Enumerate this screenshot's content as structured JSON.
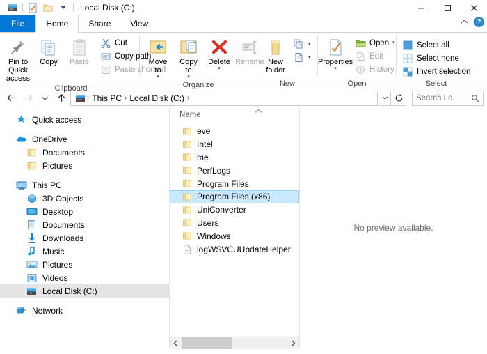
{
  "window": {
    "title": "Local Disk (C:)",
    "quick_access_toolbar": [
      {
        "name": "drive-icon",
        "label": "Local Disk"
      },
      {
        "name": "properties-check-icon",
        "label": "Properties"
      },
      {
        "name": "new-folder-icon",
        "label": "New folder"
      },
      {
        "name": "customize-qat-icon",
        "label": "Customize Quick Access Toolbar"
      }
    ],
    "controls": {
      "minimize": "—",
      "maximize": "□",
      "close": "✕",
      "collapse_ribbon": "⌃",
      "help": "?"
    }
  },
  "tabs": [
    {
      "label": "File",
      "active": false,
      "file": true
    },
    {
      "label": "Home",
      "active": true,
      "file": false
    },
    {
      "label": "Share",
      "active": false,
      "file": false
    },
    {
      "label": "View",
      "active": false,
      "file": false
    }
  ],
  "ribbon": {
    "groups": [
      {
        "name": "clipboard",
        "label": "Clipboard",
        "big_buttons": [
          {
            "label": "Pin to Quick access",
            "icon": "pin-icon",
            "disabled": false
          },
          {
            "label": "Copy",
            "icon": "copy-icon",
            "disabled": false
          },
          {
            "label": "Paste",
            "icon": "paste-icon",
            "disabled": true
          }
        ],
        "small_buttons": [
          {
            "label": "Cut",
            "icon": "scissors-icon",
            "disabled": false
          },
          {
            "label": "Copy path",
            "icon": "copy-path-icon",
            "disabled": false
          },
          {
            "label": "Paste shortcut",
            "icon": "paste-shortcut-icon",
            "disabled": true
          }
        ]
      },
      {
        "name": "organize",
        "label": "Organize",
        "big_buttons": [
          {
            "label": "Move to",
            "icon": "move-to-icon",
            "disabled": false,
            "dropdown": true
          },
          {
            "label": "Copy to",
            "icon": "copy-to-icon",
            "disabled": false,
            "dropdown": true
          },
          {
            "label": "Delete",
            "icon": "delete-x-icon",
            "disabled": false,
            "dropdown": true
          },
          {
            "label": "Rename",
            "icon": "rename-icon",
            "disabled": true
          }
        ],
        "small_buttons": []
      },
      {
        "name": "new",
        "label": "New",
        "big_buttons": [
          {
            "label": "New folder",
            "icon": "new-folder-icon",
            "disabled": false
          }
        ],
        "small_buttons": [
          {
            "label": "",
            "icon": "new-item-icon",
            "disabled": false,
            "dropdown": true
          },
          {
            "label": "",
            "icon": "easy-access-icon",
            "disabled": false,
            "dropdown": true
          }
        ]
      },
      {
        "name": "open",
        "label": "Open",
        "big_buttons": [
          {
            "label": "Properties",
            "icon": "properties-icon",
            "disabled": false,
            "dropdown": true
          }
        ],
        "small_buttons": [
          {
            "label": "Open",
            "icon": "open-folder-icon",
            "disabled": false,
            "dropdown": true
          },
          {
            "label": "Edit",
            "icon": "edit-icon",
            "disabled": true
          },
          {
            "label": "History",
            "icon": "history-icon",
            "disabled": true
          }
        ]
      },
      {
        "name": "select",
        "label": "Select",
        "big_buttons": [],
        "small_buttons": [
          {
            "label": "Select all",
            "icon": "select-all-icon",
            "disabled": false
          },
          {
            "label": "Select none",
            "icon": "select-none-icon",
            "disabled": false
          },
          {
            "label": "Invert selection",
            "icon": "invert-selection-icon",
            "disabled": false
          }
        ]
      }
    ]
  },
  "address_bar": {
    "back": "←",
    "forward": "→",
    "recent": "⌄",
    "up": "↑",
    "breadcrumbs": [
      {
        "label": "This PC"
      },
      {
        "label": "Local Disk (C:)"
      }
    ],
    "separator": "›",
    "dropdown": "⌄",
    "refresh": "↻",
    "search_placeholder": "Search Lo...",
    "search_value": ""
  },
  "nav_pane": {
    "sections": [
      {
        "items": [
          {
            "label": "Quick access",
            "icon": "star-pin-icon",
            "indent": false,
            "selected": false
          }
        ]
      },
      {
        "items": [
          {
            "label": "OneDrive",
            "icon": "onedrive-cloud-icon",
            "indent": false,
            "selected": false
          },
          {
            "label": "Documents",
            "icon": "folder-icon",
            "indent": true,
            "selected": false
          },
          {
            "label": "Pictures",
            "icon": "folder-icon",
            "indent": true,
            "selected": false
          }
        ]
      },
      {
        "items": [
          {
            "label": "This PC",
            "icon": "monitor-icon",
            "indent": false,
            "selected": false
          },
          {
            "label": "3D Objects",
            "icon": "cube-icon",
            "indent": true,
            "selected": false
          },
          {
            "label": "Desktop",
            "icon": "desktop-icon",
            "indent": true,
            "selected": false
          },
          {
            "label": "Documents",
            "icon": "documents-icon",
            "indent": true,
            "selected": false
          },
          {
            "label": "Downloads",
            "icon": "download-arrow-icon",
            "indent": true,
            "selected": false
          },
          {
            "label": "Music",
            "icon": "music-note-icon",
            "indent": true,
            "selected": false
          },
          {
            "label": "Pictures",
            "icon": "pictures-icon",
            "indent": true,
            "selected": false
          },
          {
            "label": "Videos",
            "icon": "videos-icon",
            "indent": true,
            "selected": false
          },
          {
            "label": "Local Disk (C:)",
            "icon": "drive-icon",
            "indent": true,
            "selected": true
          }
        ]
      },
      {
        "items": [
          {
            "label": "Network",
            "icon": "network-icon",
            "indent": false,
            "selected": false
          }
        ]
      }
    ]
  },
  "file_list": {
    "column_header": "Name",
    "sort_indicator": "⌃",
    "items": [
      {
        "name": "eve",
        "type": "folder",
        "selected": false
      },
      {
        "name": "Intel",
        "type": "folder",
        "selected": false
      },
      {
        "name": "me",
        "type": "folder",
        "selected": false
      },
      {
        "name": "PerfLogs",
        "type": "folder",
        "selected": false
      },
      {
        "name": "Program Files",
        "type": "folder",
        "selected": false
      },
      {
        "name": "Program Files (x86)",
        "type": "folder",
        "selected": true
      },
      {
        "name": "UniConverter",
        "type": "folder",
        "selected": false
      },
      {
        "name": "Users",
        "type": "folder",
        "selected": false
      },
      {
        "name": "Windows",
        "type": "folder",
        "selected": false
      },
      {
        "name": "logWSVCUUpdateHelper",
        "type": "file",
        "selected": false
      }
    ],
    "hscroll": {
      "left_arrow": "‹",
      "right_arrow": "›"
    }
  },
  "preview_pane": {
    "message": "No preview available."
  },
  "colors": {
    "accent": "#0078d7",
    "selection": "#cce8ff",
    "selection_border": "#99d1ff",
    "nav_selection": "#e5e5e5",
    "folder": "#fcdf8a",
    "border": "#d4d4d4"
  }
}
